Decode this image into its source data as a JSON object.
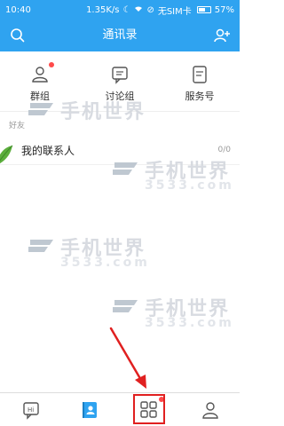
{
  "status_bar": {
    "time": "10:40",
    "network_speed": "1.35K/s",
    "sim_text": "无SIM卡",
    "battery_percent": "57%",
    "battery_level": 0.57
  },
  "app_bar": {
    "title": "通讯录",
    "search_icon": "search-icon",
    "add_icon": "add-user-icon"
  },
  "categories": [
    {
      "label": "群组",
      "icon": "group-icon",
      "badge": true
    },
    {
      "label": "讨论组",
      "icon": "discussion-icon",
      "badge": false
    },
    {
      "label": "服务号",
      "icon": "service-icon",
      "badge": false
    }
  ],
  "section": {
    "label": "好友"
  },
  "contacts": {
    "name": "我的联系人",
    "count": "0/0"
  },
  "watermark": {
    "text": "手机世界",
    "sub": "3533.com"
  },
  "tabs": [
    {
      "icon": "chat-icon",
      "active": false
    },
    {
      "icon": "contacts-icon",
      "active": true
    },
    {
      "icon": "apps-grid-icon",
      "active": false,
      "highlighted": true,
      "badge": true
    },
    {
      "icon": "profile-icon",
      "active": false
    }
  ],
  "colors": {
    "accent": "#2fa3f0",
    "badge": "#ff4a4a",
    "highlight": "#e02020"
  }
}
